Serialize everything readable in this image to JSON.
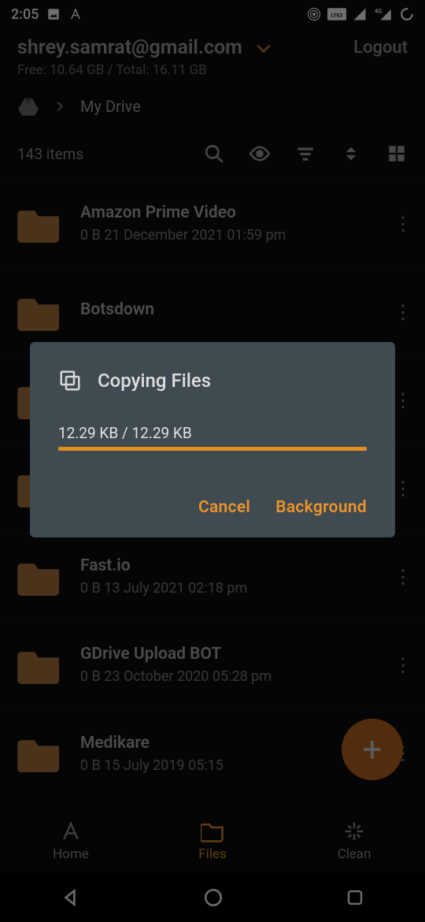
{
  "status": {
    "time": "2:05",
    "icons_left": [
      "image-icon",
      "app-a-icon"
    ],
    "icons_right": [
      "hotspot-icon",
      "volte-icon",
      "signal-icon",
      "4g-signal-icon",
      "loading-icon"
    ]
  },
  "account": {
    "email": "shrey.samrat@gmail.com",
    "storage": "Free: 10.64 GB / Total: 16.11 GB",
    "logout": "Logout"
  },
  "breadcrumb": {
    "root_icon": "drive-icon",
    "current": "My Drive"
  },
  "toolbar": {
    "count": "143 items"
  },
  "files": [
    {
      "name": "Amazon Prime Video",
      "sub": "0 B 21 December 2021 01:59 pm"
    },
    {
      "name": "Botsdown",
      "sub": ""
    },
    {
      "name": "",
      "sub": ""
    },
    {
      "name": "",
      "sub": ""
    },
    {
      "name": "Fast.io",
      "sub": "0 B 13 July 2021 02:18 pm"
    },
    {
      "name": "GDrive Upload BOT",
      "sub": "0 B 23 October 2020 05:28 pm"
    },
    {
      "name": "Medikare",
      "sub": "0 B 15 July 2019 05:15"
    }
  ],
  "fab": {
    "glyph": "+"
  },
  "bottom_nav": {
    "items": [
      {
        "label": "Home",
        "active": false
      },
      {
        "label": "Files",
        "active": true
      },
      {
        "label": "Clean",
        "active": false
      }
    ]
  },
  "dialog": {
    "title": "Copying Files",
    "progress_text": "12.29 KB / 12.29 KB",
    "progress_pct": 100,
    "cancel": "Cancel",
    "background": "Background"
  },
  "colors": {
    "accent": "#e18f1f",
    "folder": "#a6703b",
    "dialog_bg": "#3f4a51"
  }
}
